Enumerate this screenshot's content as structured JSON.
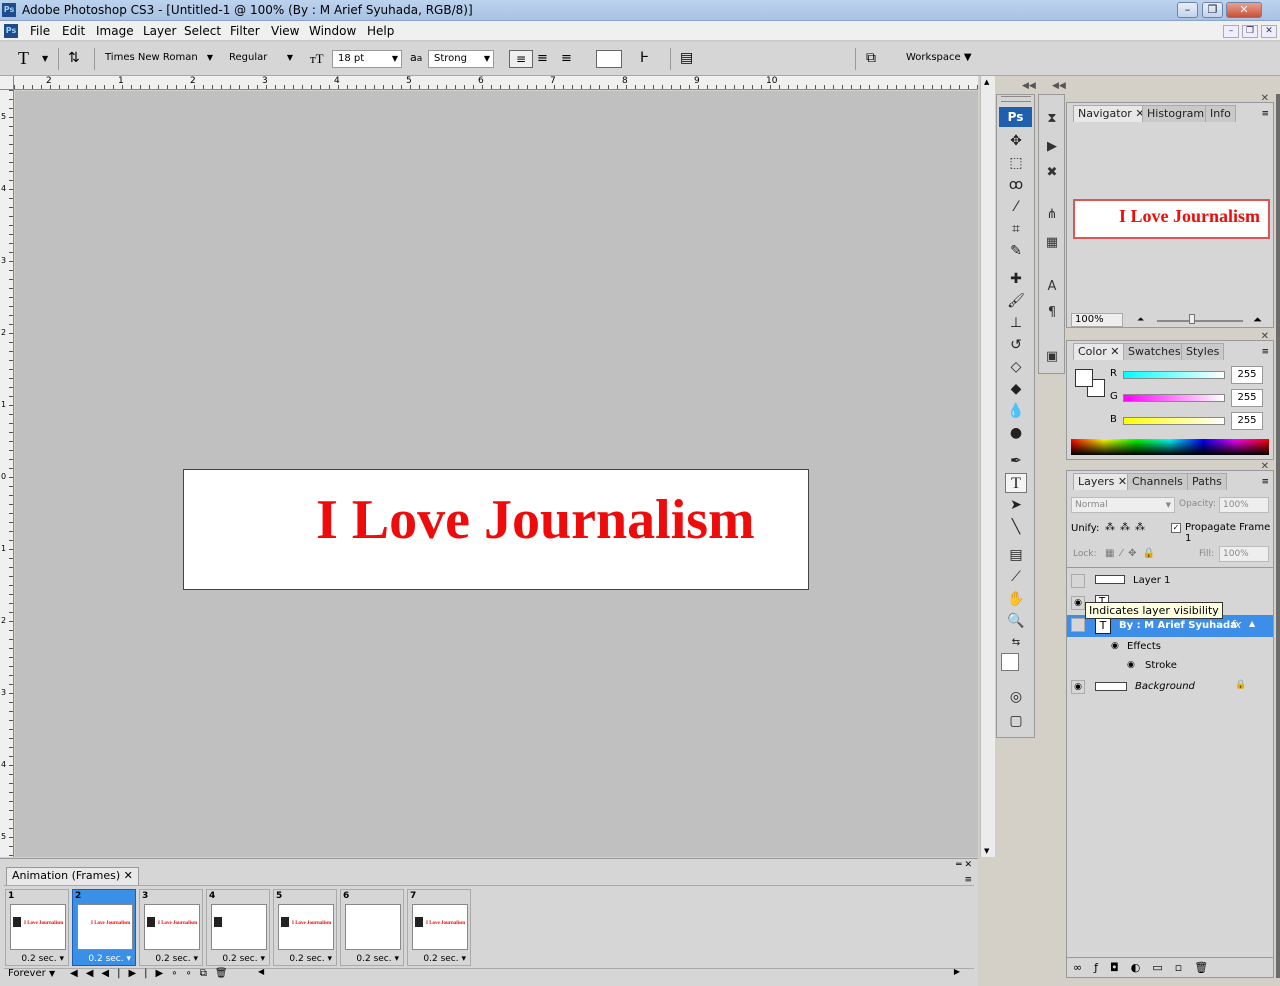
{
  "window": {
    "title": "Adobe Photoshop CS3 - [Untitled-1 @ 100% (By : M Arief Syuhada, RGB/8)]",
    "app_icon": "Ps"
  },
  "menu": [
    "File",
    "Edit",
    "Image",
    "Layer",
    "Select",
    "Filter",
    "View",
    "Window",
    "Help"
  ],
  "options": {
    "font_family": "Times New Roman",
    "font_style": "Regular",
    "font_size": "18 pt",
    "aa_label": "a",
    "antialias": "Strong",
    "workspace": "Workspace"
  },
  "ruler_top": [
    "2",
    "1",
    "2",
    "3",
    "4",
    "5",
    "6",
    "7",
    "8",
    "9",
    "10"
  ],
  "ruler_left": [
    "5",
    "4",
    "3",
    "2",
    "1",
    "0",
    "1",
    "2",
    "3",
    "4",
    "5"
  ],
  "document": {
    "text": "I Love Journalism"
  },
  "animation": {
    "tab": "Animation (Frames)",
    "loop": "Forever",
    "frames": [
      {
        "num": "1",
        "delay": "0.2 sec.",
        "thumb_text": "I Love Journalism"
      },
      {
        "num": "2",
        "delay": "0.2 sec.",
        "thumb_text": "I Love Journalism"
      },
      {
        "num": "3",
        "delay": "0.2 sec.",
        "thumb_text": "I Love Journalism"
      },
      {
        "num": "4",
        "delay": "0.2 sec.",
        "thumb_text": ""
      },
      {
        "num": "5",
        "delay": "0.2 sec.",
        "thumb_text": "I Love Journalism"
      },
      {
        "num": "6",
        "delay": "0.2 sec.",
        "thumb_text": ""
      },
      {
        "num": "7",
        "delay": "0.2 sec.",
        "thumb_text": "I Love Journalism"
      }
    ]
  },
  "tools_header": "Ps",
  "navigator": {
    "tabs": [
      "Navigator",
      "Histogram",
      "Info"
    ],
    "preview_text": "I Love Journalism",
    "zoom": "100%"
  },
  "color": {
    "tabs": [
      "Color",
      "Swatches",
      "Styles"
    ],
    "channels": [
      {
        "label": "R",
        "value": "255"
      },
      {
        "label": "G",
        "value": "255"
      },
      {
        "label": "B",
        "value": "255"
      }
    ]
  },
  "layers": {
    "tabs": [
      "Layers",
      "Channels",
      "Paths"
    ],
    "blend_mode": "Normal",
    "opacity_label": "Opacity:",
    "opacity": "100%",
    "unify_label": "Unify:",
    "propagate_label": "Propagate Frame 1",
    "lock_label": "Lock:",
    "fill_label": "Fill:",
    "fill": "100%",
    "items": {
      "layer1": "Layer 1",
      "selected": "By : M Arief Syuhada",
      "effects": "Effects",
      "stroke": "Stroke",
      "background": "Background"
    },
    "tooltip": "Indicates layer visibility"
  }
}
